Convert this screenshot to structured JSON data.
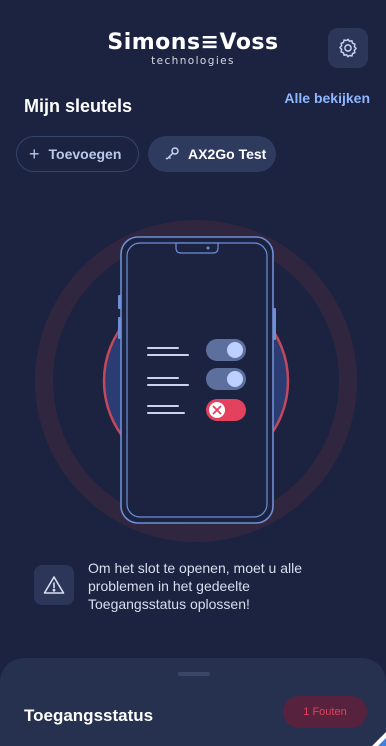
{
  "header": {
    "logo_main": "Simons≡Voss",
    "logo_sub": "technologies",
    "settings_icon": "gear-icon"
  },
  "keys": {
    "title": "Mijn sleutels",
    "see_all": "Alle bekijken",
    "add_label": "Toevoegen",
    "add_icon": "plus-icon",
    "key_label": "AX2Go Test",
    "key_icon": "key-icon"
  },
  "illustration": {
    "toggle_states": [
      "on",
      "on",
      "error"
    ]
  },
  "message": {
    "icon": "warning-triangle-icon",
    "text": "Om het slot te openen, moet u alle problemen in het gedeelte Toegangsstatus oplossen!"
  },
  "status_sheet": {
    "title": "Toegangsstatus",
    "badge": "1 Fouten"
  },
  "colors": {
    "background": "#1b2340",
    "accent": "#8fb6ff",
    "error": "#e3415e",
    "toggle_on": "#8fb0f0"
  }
}
